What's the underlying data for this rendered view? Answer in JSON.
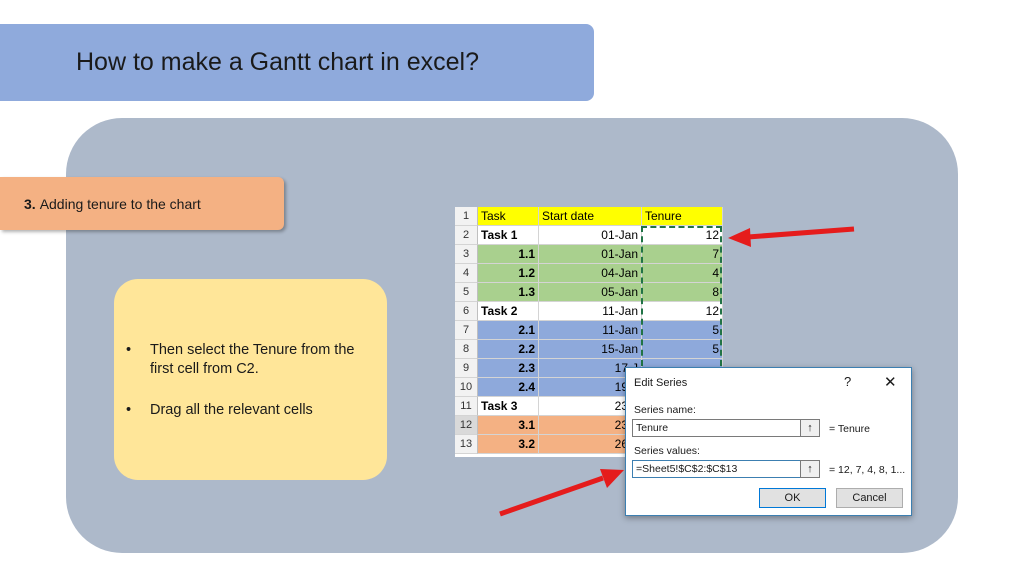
{
  "slide": {
    "title": "How to make a Gantt chart in excel?",
    "step_number": "3.",
    "step_text": "Adding tenure to the chart",
    "bullets": [
      "Then select the Tenure from the first cell from C2.",
      "Drag all the relevant cells"
    ]
  },
  "sheet": {
    "headers": [
      "Task",
      "Start date",
      "Tenure"
    ],
    "rows": [
      {
        "n": "1",
        "a": "Task",
        "b": "Start date",
        "c": "Tenure"
      },
      {
        "n": "2",
        "a": "Task 1",
        "b": "01-Jan",
        "c": "12"
      },
      {
        "n": "3",
        "a": "1.1",
        "b": "01-Jan",
        "c": "7"
      },
      {
        "n": "4",
        "a": "1.2",
        "b": "04-Jan",
        "c": "4"
      },
      {
        "n": "5",
        "a": "1.3",
        "b": "05-Jan",
        "c": "8"
      },
      {
        "n": "6",
        "a": "Task 2",
        "b": "11-Jan",
        "c": "12"
      },
      {
        "n": "7",
        "a": "2.1",
        "b": "11-Jan",
        "c": "5"
      },
      {
        "n": "8",
        "a": "2.2",
        "b": "15-Jan",
        "c": "5"
      },
      {
        "n": "9",
        "a": "2.3",
        "b": "17-J",
        "c": ""
      },
      {
        "n": "10",
        "a": "2.4",
        "b": "19-J",
        "c": ""
      },
      {
        "n": "11",
        "a": "Task 3",
        "b": "23-J",
        "c": ""
      },
      {
        "n": "12",
        "a": "3.1",
        "b": "23-J",
        "c": ""
      },
      {
        "n": "13",
        "a": "3.2",
        "b": "26-J",
        "c": ""
      }
    ]
  },
  "dialog": {
    "title": "Edit Series",
    "help": "?",
    "close": "✕",
    "series_name_label": "Series name:",
    "series_name_value": "Tenure",
    "series_name_result": "= Tenure",
    "series_values_label": "Series values:",
    "series_values_value": "=Sheet5!$C$2:$C$13",
    "series_values_result": "= 12, 7, 4, 8, 1...",
    "collapse_icon": "↑",
    "ok": "OK",
    "cancel": "Cancel"
  },
  "colors": {
    "header_band": "#8faadc",
    "panel": "#adb9ca",
    "step": "#f4b183",
    "note": "#ffe699",
    "arrow": "#e51c1c"
  }
}
